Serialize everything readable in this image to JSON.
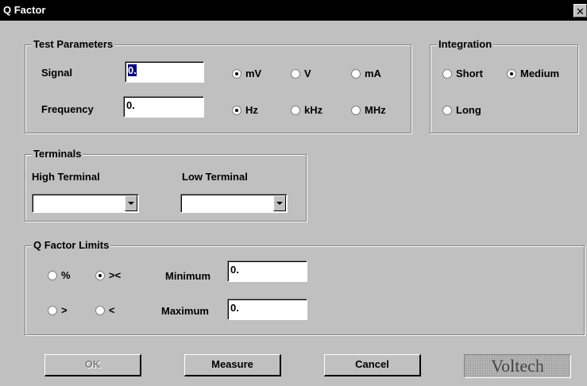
{
  "window": {
    "title": "Q Factor",
    "close_label": "✕"
  },
  "test_parameters": {
    "legend": "Test Parameters",
    "signal": {
      "label": "Signal",
      "value": "0.",
      "units": [
        {
          "label": "mV",
          "selected": true
        },
        {
          "label": "V",
          "selected": false
        },
        {
          "label": "mA",
          "selected": false
        }
      ]
    },
    "frequency": {
      "label": "Frequency",
      "value": "0.",
      "units": [
        {
          "label": "Hz",
          "selected": true
        },
        {
          "label": "kHz",
          "selected": false
        },
        {
          "label": "MHz",
          "selected": false
        }
      ]
    }
  },
  "integration": {
    "legend": "Integration",
    "options": [
      {
        "label": "Short",
        "selected": false
      },
      {
        "label": "Medium",
        "selected": true
      },
      {
        "label": "Long",
        "selected": false
      }
    ]
  },
  "terminals": {
    "legend": "Terminals",
    "high_label": "High Terminal",
    "high_value": "",
    "low_label": "Low Terminal",
    "low_value": ""
  },
  "limits": {
    "legend": "Q Factor Limits",
    "options": [
      {
        "label": "%",
        "selected": false
      },
      {
        "label": "><",
        "selected": true
      },
      {
        "label": ">",
        "selected": false
      },
      {
        "label": "<",
        "selected": false
      }
    ],
    "minimum_label": "Minimum",
    "minimum_value": "0.",
    "maximum_label": "Maximum",
    "maximum_value": "0."
  },
  "buttons": {
    "ok": "OK",
    "measure": "Measure",
    "cancel": "Cancel"
  },
  "logo_text": "Voltech"
}
